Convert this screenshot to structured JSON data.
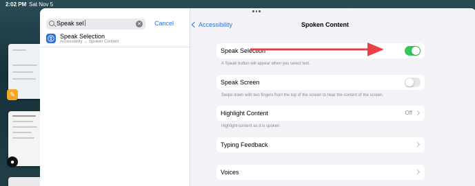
{
  "status": {
    "time": "2:02 PM",
    "date": "Sat Nov 5"
  },
  "sidebar": {
    "search": {
      "value": "Speak sel"
    },
    "cancel_label": "Cancel",
    "results": [
      {
        "title": "Speak Selection",
        "path": "Accessibility → Spoken Content"
      }
    ]
  },
  "detail": {
    "back_label": "Accessibility",
    "title": "Spoken Content",
    "rows": [
      {
        "label": "Speak Selection",
        "control": "toggle",
        "on": true,
        "footer": "A Speak button will appear when you select text."
      },
      {
        "label": "Speak Screen",
        "control": "toggle",
        "on": false,
        "footer": "Swipe down with two fingers from the top of the screen to hear the content of the screen."
      },
      {
        "label": "Highlight Content",
        "control": "disclosure",
        "value": "Off",
        "footer": "Highlight content as it is spoken."
      },
      {
        "label": "Typing Feedback",
        "control": "disclosure"
      },
      {
        "label": "Voices",
        "control": "disclosure"
      }
    ]
  },
  "colors": {
    "accent": "#2f6fd6",
    "toggle_on": "#34c759",
    "annotation_arrow": "#e8414a"
  },
  "icons": [
    "search-icon",
    "clear-icon",
    "accessibility-icon",
    "back-chevron-icon",
    "chevron-right-icon",
    "pages-app-icon",
    "messages-app-icon"
  ]
}
